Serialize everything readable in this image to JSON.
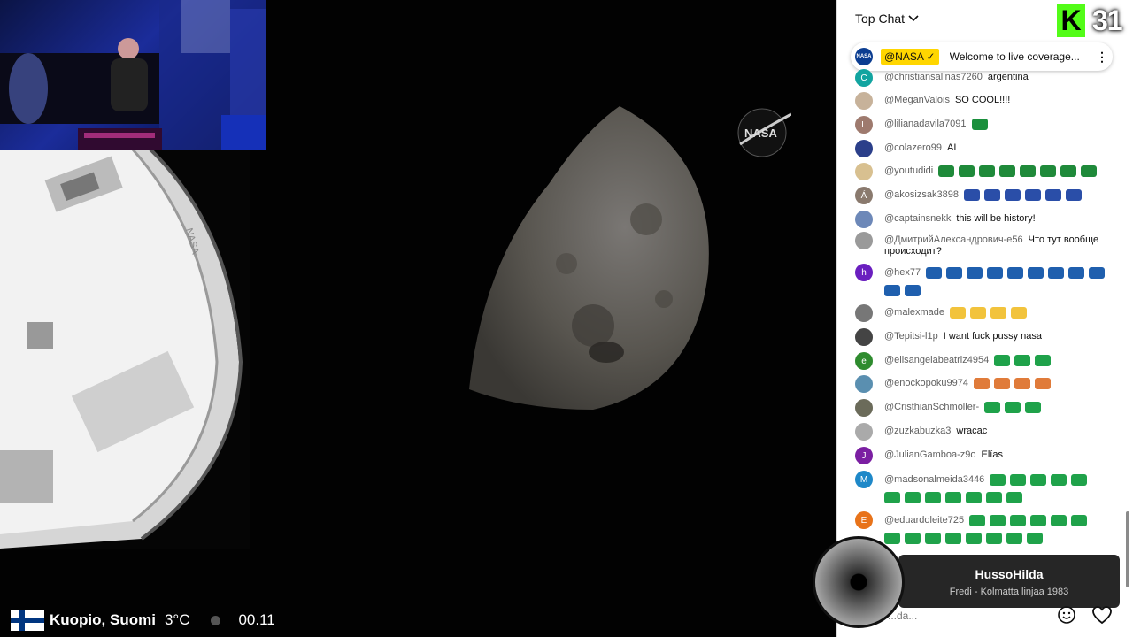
{
  "overlay": {
    "location": "Kuopio, Suomi",
    "temperature": "3°C",
    "clock": "00.11",
    "viewer_count": "31",
    "streaming_platform_icon": "kick-logo-icon"
  },
  "video": {
    "logo_text": "NASA",
    "capsule_label": "NASA"
  },
  "chat": {
    "header_label": "Top Chat",
    "pinned": {
      "author": "@NASA",
      "message": "Welcome to live coverage...",
      "verified_icon": "check-icon"
    },
    "messages": [
      {
        "user": "@christiansalinas7260",
        "text": "argentina",
        "initial": "C",
        "avatar_color": "#12a4a0"
      },
      {
        "user": "@MeganValois",
        "text": "SO COOL!!!!",
        "initial": "",
        "avatar_color": "#c7b29a"
      },
      {
        "user": "@lilianadavila7091",
        "text": "",
        "initial": "L",
        "avatar_color": "#9e7a6e"
      },
      {
        "user": "@colazero99",
        "text": "AI",
        "initial": "",
        "avatar_color": "#2b3f8a"
      },
      {
        "user": "@youtudidi",
        "text": "",
        "initial": "",
        "avatar_color": "#d8c090"
      },
      {
        "user": "@akosizsak3898",
        "text": "",
        "initial": "Á",
        "avatar_color": "#8a7a6e"
      },
      {
        "user": "@captainsnekk",
        "text": "this will be history!",
        "initial": "",
        "avatar_color": "#6d88b8"
      },
      {
        "user": "@ДмитрийАлександрович-е56",
        "text": "Что тут вообще происходит?",
        "initial": "",
        "avatar_color": "#9a9a9a"
      },
      {
        "user": "@hex77",
        "text": "",
        "initial": "h",
        "avatar_color": "#6a1fbf"
      },
      {
        "user": "@malexmade",
        "text": "",
        "initial": "",
        "avatar_color": "#777"
      },
      {
        "user": "@Tepitsi-l1p",
        "text": "I want fuck pussy nasa",
        "initial": "",
        "avatar_color": "#444"
      },
      {
        "user": "@elisangelabeatriz4954",
        "text": "",
        "initial": "e",
        "avatar_color": "#2e8b2e"
      },
      {
        "user": "@enockopoku9974",
        "text": "",
        "initial": "",
        "avatar_color": "#5a8fb0"
      },
      {
        "user": "@CristhianSchmoller-",
        "text": "",
        "initial": "",
        "avatar_color": "#6b6b5a"
      },
      {
        "user": "@zuzkabuzka3",
        "text": "wracac",
        "initial": "",
        "avatar_color": "#aaaaaa"
      },
      {
        "user": "@JulianGamboa-z9o",
        "text": "Elías",
        "initial": "J",
        "avatar_color": "#7b1fa2"
      },
      {
        "user": "@madsonalmeida3446",
        "text": "",
        "initial": "M",
        "avatar_color": "#1e88c8"
      },
      {
        "user": "@eduardoleite725",
        "text": "",
        "initial": "E",
        "avatar_color": "#e8731a"
      }
    ],
    "input_placeholder": "...da...",
    "colors": {
      "mexico": "#1a8f3c",
      "portugal": "#1f8a3a",
      "slovakia": "#2a4ea8",
      "sweden": "#1f5fae",
      "brazil": "#1fa24a",
      "clap": "#f2c33c",
      "face": "#e07b3a"
    }
  },
  "music": {
    "artist": "HussoHilda",
    "track": "Fredi - Kolmatta linjaa 1983"
  }
}
